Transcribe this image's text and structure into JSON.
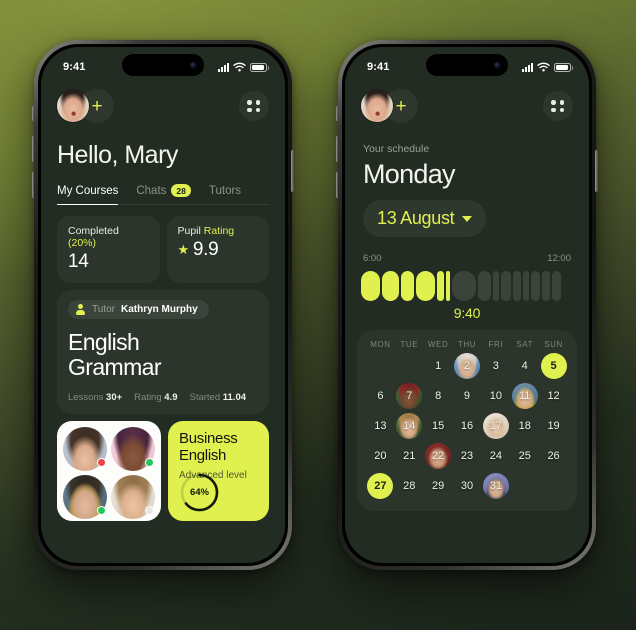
{
  "theme": {
    "accent": "#dff04f",
    "screen_bg": "#232c23",
    "card_bg": "#2c352c"
  },
  "left_phone": {
    "status": {
      "time": "9:41"
    },
    "header": {
      "add_label": "+"
    },
    "greeting": "Hello, Mary",
    "tabs": [
      {
        "label": "My Courses",
        "active": true,
        "badge": ""
      },
      {
        "label": "Chats",
        "active": false,
        "badge": "28"
      },
      {
        "label": "Tutors",
        "active": false,
        "badge": ""
      }
    ],
    "stats": [
      {
        "label": "Completed",
        "highlight": "(20%)",
        "value": "14",
        "star": false
      },
      {
        "label": "Pupil",
        "highlight": "Rating",
        "value": "9.9",
        "star": true
      }
    ],
    "course": {
      "tutor_label": "Tutor",
      "tutor_name": "Kathryn Murphy",
      "title_line1": "English",
      "title_line2": "Grammar",
      "meta": [
        {
          "label": "Lessons",
          "value": "30+"
        },
        {
          "label": "Rating",
          "value": "4.9"
        },
        {
          "label": "Started",
          "value": "11.04"
        }
      ]
    },
    "students": [
      {
        "status_color": "#ef4444"
      },
      {
        "status_color": "#22c55e"
      },
      {
        "status_color": "#22c55e"
      },
      {
        "status_color": "#e8e8e6"
      }
    ],
    "business": {
      "title_line1": "Business",
      "title_line2": "English",
      "subtitle": "Advanced level",
      "progress_label": "64%",
      "progress_value": 64
    }
  },
  "right_phone": {
    "status": {
      "time": "9:41"
    },
    "header": {
      "add_label": "+"
    },
    "schedule_label": "Your schedule",
    "day": "Monday",
    "date_pill": "13 August",
    "timeline": {
      "start_label": "6:00",
      "end_label": "12:00",
      "now_label": "9:40",
      "slots": [
        {
          "w": 19,
          "r": 10,
          "active": true
        },
        {
          "w": 17,
          "r": 9,
          "active": true
        },
        {
          "w": 13,
          "r": 7,
          "active": true
        },
        {
          "w": 19,
          "r": 10,
          "active": true
        },
        {
          "w": 7,
          "r": 4,
          "active": true
        },
        {
          "w": 4,
          "r": 2,
          "active": true
        },
        {
          "w": 24,
          "r": 12,
          "active": false
        },
        {
          "w": 13,
          "r": 7,
          "active": false
        },
        {
          "w": 6,
          "r": 3,
          "active": false
        },
        {
          "w": 10,
          "r": 5,
          "active": false
        },
        {
          "w": 8,
          "r": 4,
          "active": false
        },
        {
          "w": 6,
          "r": 3,
          "active": false
        },
        {
          "w": 9,
          "r": 5,
          "active": false
        },
        {
          "w": 8,
          "r": 4,
          "active": false
        },
        {
          "w": 9,
          "r": 5,
          "active": false
        }
      ]
    },
    "calendar": {
      "weekdays": [
        "MON",
        "TUE",
        "WED",
        "THU",
        "FRI",
        "SAT",
        "SUN"
      ],
      "weeks": [
        [
          {
            "n": ""
          },
          {
            "n": ""
          },
          {
            "n": "1"
          },
          {
            "n": "2",
            "photo": "ph-a"
          },
          {
            "n": "3"
          },
          {
            "n": "4"
          },
          {
            "n": "5",
            "selected": true
          }
        ],
        [
          {
            "n": "6"
          },
          {
            "n": "7",
            "photo": "ph-b"
          },
          {
            "n": "8"
          },
          {
            "n": "9"
          },
          {
            "n": "10"
          },
          {
            "n": "11",
            "photo": "ph-c"
          },
          {
            "n": "12"
          }
        ],
        [
          {
            "n": "13"
          },
          {
            "n": "14",
            "photo": "ph-d"
          },
          {
            "n": "15"
          },
          {
            "n": "16"
          },
          {
            "n": "17",
            "photo": "ph-e"
          },
          {
            "n": "18"
          },
          {
            "n": "19"
          }
        ],
        [
          {
            "n": "20"
          },
          {
            "n": "21"
          },
          {
            "n": "22",
            "photo": "ph-f"
          },
          {
            "n": "23"
          },
          {
            "n": "24"
          },
          {
            "n": "25"
          },
          {
            "n": "26"
          }
        ],
        [
          {
            "n": "27",
            "selected": true
          },
          {
            "n": "28"
          },
          {
            "n": "29"
          },
          {
            "n": "30"
          },
          {
            "n": "31",
            "photo": "ph-g"
          },
          {
            "n": ""
          },
          {
            "n": ""
          }
        ]
      ]
    }
  }
}
